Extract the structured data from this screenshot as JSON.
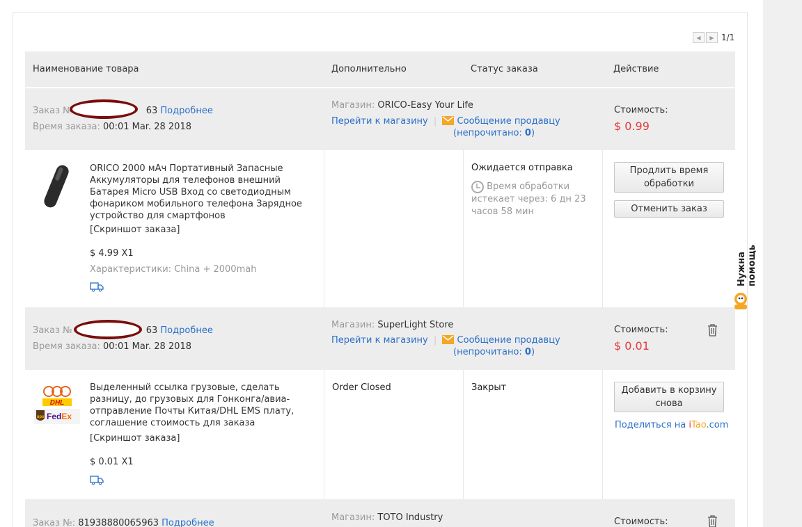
{
  "pager": {
    "prev_icon": "arrow-left-icon",
    "next_icon": "arrow-right-icon",
    "page": "1/1"
  },
  "table_header": {
    "product": "Наименование товара",
    "extra": "Дополнительно",
    "status": "Статус заказа",
    "action": "Действие"
  },
  "orders": [
    {
      "order_label": "Заказ №",
      "order_suffix": "63",
      "details_link": "Подробнее",
      "time_label": "Время заказа:",
      "time_value": "00:01 Mar. 28 2018",
      "store_label": "Магазин:",
      "store_name": "ORICO-Easy Your Life",
      "goto_store": "Перейти к магазину",
      "separator": "|",
      "message_seller": "Сообщение продавцу",
      "unread_prefix": "(непрочитано:",
      "unread_count": "0",
      "unread_suffix": ")",
      "cost_label": "Стоимость:",
      "cost_value": "$ 0.99",
      "item": {
        "title": "ORICO 2000 мАч Портативный Запасные Аккумуляторы для телефонов внешний Батарея Micro USB Вход со светодиодным фонариком мобильного телефона Зарядное устройство для смартфонов",
        "snapshot": "[Скриншот заказа]",
        "price_qty": "$ 4.99 X1",
        "specs": "Характеристики: China + 2000mah",
        "extra": "",
        "status": "Ожидается отправка",
        "timer_text": "Время обработки истекает через: 6 дн 23 часов 58 мин",
        "btn1": "Продлить время обработки",
        "btn2": "Отменить заказ"
      }
    },
    {
      "order_label": "Заказ №",
      "order_suffix": "63",
      "details_link": "Подробнее",
      "time_label": "Время заказа:",
      "time_value": "00:01 Mar. 28 2018",
      "store_label": "Магазин:",
      "store_name": "SuperLight Store",
      "goto_store": "Перейти к магазину",
      "separator": "|",
      "message_seller": "Сообщение продавцу",
      "unread_prefix": "(непрочитано:",
      "unread_count": "0",
      "unread_suffix": ")",
      "cost_label": "Стоимость:",
      "cost_value": "$ 0.01",
      "item": {
        "title": "Выделенный ссылка грузовые, сделать разницу, до грузовых для Гонконга/авиа-отправление Почты Китая/DHL EMS плату, соглашение стоимость для заказа",
        "snapshot": "[Скриншот заказа]",
        "price_qty": "$ 0.01 X1",
        "extra": "Order Closed",
        "status": "Закрыт",
        "btn1": "Добавить в корзину снова",
        "share_prefix": "Поделиться на ",
        "share_i": "i",
        "share_tao": "Tao",
        "share_com": ".com"
      }
    },
    {
      "order_label": "Заказ №:",
      "order_number": "81938880065963",
      "details_link": "Подробнее",
      "store_label": "Магазин:",
      "store_name": "TOTO Industry",
      "cost_label": "Стоимость:"
    }
  ],
  "logos": {
    "tnt": "TNT",
    "dhl": "DHL",
    "ups": "ups",
    "fedex": "FedEx"
  },
  "help": {
    "label": "Нужна помощь"
  },
  "colors": {
    "link": "#2a6fc9",
    "price": "#e4393c",
    "header_bg": "#ededed",
    "mask": "#7a0d0d"
  }
}
